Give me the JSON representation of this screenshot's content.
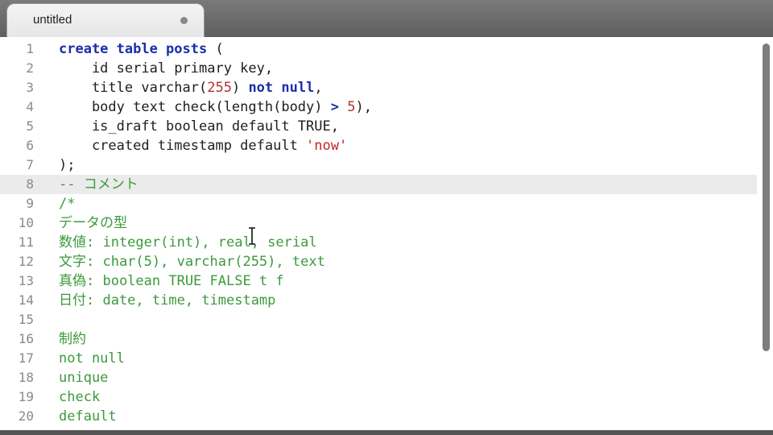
{
  "tab": {
    "title": "untitled",
    "icon": "unsaved-dot-icon"
  },
  "colors": {
    "keyword": "#1b2fa8",
    "number": "#b03030",
    "string": "#c0282a",
    "comment": "#3c9a3c",
    "text": "#202020",
    "line_number": "#8a8a8a"
  },
  "lines": [
    {
      "n": "1",
      "tokens": [
        [
          "create table posts",
          "kw"
        ],
        [
          " (",
          ""
        ]
      ]
    },
    {
      "n": "2",
      "tokens": [
        [
          "    id serial primary key,",
          ""
        ]
      ]
    },
    {
      "n": "3",
      "tokens": [
        [
          "    title varchar(",
          ""
        ],
        [
          "255",
          "num"
        ],
        [
          ") ",
          ""
        ],
        [
          "not null",
          "kw"
        ],
        [
          ",",
          ""
        ]
      ]
    },
    {
      "n": "4",
      "tokens": [
        [
          "    body text check(length(body) ",
          ""
        ],
        [
          ">",
          "kw"
        ],
        [
          " ",
          ""
        ],
        [
          "5",
          "num"
        ],
        [
          "),",
          ""
        ]
      ]
    },
    {
      "n": "5",
      "tokens": [
        [
          "    is_draft boolean default TRUE,",
          ""
        ]
      ]
    },
    {
      "n": "6",
      "tokens": [
        [
          "    created timestamp default ",
          ""
        ],
        [
          "'now'",
          "str"
        ]
      ]
    },
    {
      "n": "7",
      "tokens": [
        [
          ");",
          ""
        ]
      ]
    },
    {
      "n": "8",
      "tokens": [
        [
          "-- コメント",
          "cm"
        ]
      ],
      "active": true
    },
    {
      "n": "9",
      "tokens": [
        [
          "/*",
          "cm"
        ]
      ]
    },
    {
      "n": "10",
      "tokens": [
        [
          "データの型",
          "cm"
        ]
      ]
    },
    {
      "n": "11",
      "tokens": [
        [
          "数値: integer(int), real, serial",
          "cm"
        ]
      ]
    },
    {
      "n": "12",
      "tokens": [
        [
          "文字: char(5), varchar(255), text",
          "cm"
        ]
      ]
    },
    {
      "n": "13",
      "tokens": [
        [
          "真偽: boolean TRUE FALSE t f",
          "cm"
        ]
      ]
    },
    {
      "n": "14",
      "tokens": [
        [
          "日付: date, time, timestamp",
          "cm"
        ]
      ]
    },
    {
      "n": "15",
      "tokens": []
    },
    {
      "n": "16",
      "tokens": [
        [
          "制約",
          "cm"
        ]
      ]
    },
    {
      "n": "17",
      "tokens": [
        [
          "not null",
          "cm"
        ]
      ]
    },
    {
      "n": "18",
      "tokens": [
        [
          "unique",
          "cm"
        ]
      ]
    },
    {
      "n": "19",
      "tokens": [
        [
          "check",
          "cm"
        ]
      ]
    },
    {
      "n": "20",
      "tokens": [
        [
          "default",
          "cm"
        ]
      ]
    }
  ]
}
